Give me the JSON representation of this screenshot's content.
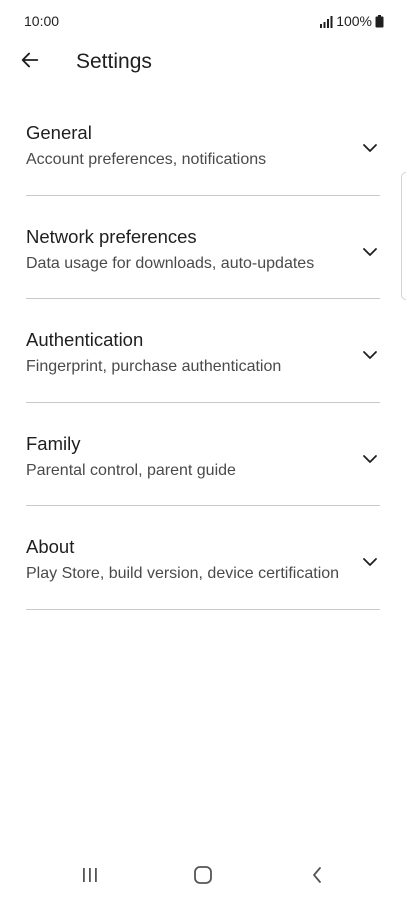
{
  "status_bar": {
    "time": "10:00",
    "battery": "100%",
    "icons": [
      "signal-icon",
      "battery-icon"
    ]
  },
  "app_bar": {
    "title": "Settings",
    "back_icon": "arrow-back-icon"
  },
  "settings": {
    "items": [
      {
        "title": "General",
        "subtitle": "Account preferences, notifications"
      },
      {
        "title": "Network preferences",
        "subtitle": "Data usage for downloads, auto-updates"
      },
      {
        "title": "Authentication",
        "subtitle": "Fingerprint, purchase authentication"
      },
      {
        "title": "Family",
        "subtitle": "Parental control, parent guide"
      },
      {
        "title": "About",
        "subtitle": "Play Store, build version, device certification"
      }
    ]
  },
  "nav_bar": {
    "icons": [
      "recent-apps-icon",
      "home-icon",
      "back-icon"
    ]
  },
  "colors": {
    "text_primary": "#1f1f1f",
    "text_secondary": "#4a4a4a",
    "divider": "#c9c9c9",
    "background": "#ffffff"
  }
}
